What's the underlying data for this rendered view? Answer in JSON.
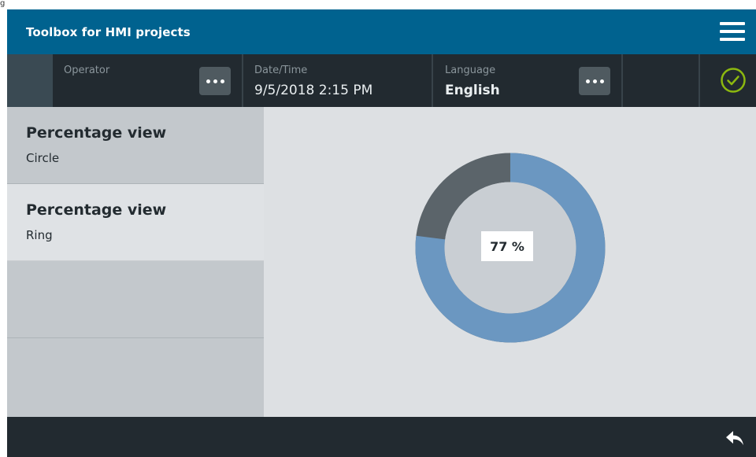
{
  "header": {
    "app_title": "Toolbox for HMI projects",
    "menu_icon": "hamburger-menu-icon",
    "corner_label": "g"
  },
  "statusbar": {
    "operator_label": "Operator",
    "operator_value": "",
    "datetime_label": "Date/Time",
    "datetime_value": "9/5/2018 2:15 PM",
    "language_label": "Language",
    "language_value": "English",
    "more_icon": "more-dots-icon",
    "status_icon": "check-circle-icon",
    "status_color": "#8cb80f"
  },
  "sidebar": {
    "items": [
      {
        "title": "Percentage view",
        "subtitle": "Circle",
        "selected": false
      },
      {
        "title": "Percentage view",
        "subtitle": "Ring",
        "selected": true
      },
      {
        "title": "",
        "subtitle": "",
        "selected": false
      },
      {
        "title": "",
        "subtitle": "",
        "selected": false
      }
    ]
  },
  "main": {
    "percentage": 77,
    "percentage_text": "77 %",
    "fill_color": "#6b97c1",
    "remainder_color": "#5b646a",
    "inner_color": "#c9ced3"
  },
  "footer": {
    "back_icon": "back-arrow-icon"
  }
}
